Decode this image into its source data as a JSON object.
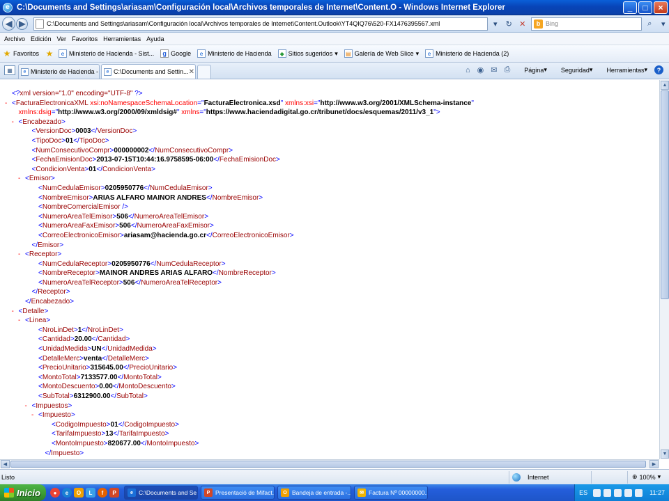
{
  "window": {
    "title": "C:\\Documents and Settings\\ariasam\\Configuración local\\Archivos temporales de Internet\\Content.O - Windows Internet Explorer"
  },
  "address": {
    "url": "C:\\Documents and Settings\\ariasam\\Configuración local\\Archivos temporales de Internet\\Content.Outlook\\YT4QIQ76\\520-FX1476395567.xml",
    "search_placeholder": "Bing"
  },
  "menu": [
    "Archivo",
    "Edición",
    "Ver",
    "Favoritos",
    "Herramientas",
    "Ayuda"
  ],
  "favorites": {
    "label": "Favoritos",
    "items": [
      "Ministerio de Hacienda - Sist...",
      "Google",
      "Ministerio de Hacienda",
      "Sitios sugeridos",
      "Galería de Web Slice",
      "Ministerio de Hacienda (2)"
    ]
  },
  "tabs": [
    {
      "label": "Ministerio de Hacienda - Siste...",
      "active": false
    },
    {
      "label": "C:\\Documents and Settin...",
      "active": true
    }
  ],
  "commands": {
    "page": "Página",
    "security": "Seguridad",
    "tools": "Herramientas"
  },
  "xml_lines": [
    {
      "ind": 0,
      "m": "",
      "html": "<span class='bl'>&lt;?</span><span class='tg'>xml version=\"1.0\" encoding=\"UTF-8\"</span><span class='bl'> ?&gt;</span>"
    },
    {
      "ind": 0,
      "m": "-",
      "html": "<span class='bl'>&lt;</span><span class='tg'>FacturaElectronicaXML</span> <span class='an'>xsi:noNamespaceSchemaLocation</span><span class='bl'>=\"</span><span class='av'>FacturaElectronica.xsd</span><span class='bl'>\"</span> <span class='an'>xmlns:xsi</span><span class='bl'>=\"</span><span class='av'>http://www.w3.org/2001/XMLSchema-instance</span><span class='bl'>\"</span>"
    },
    {
      "ind": 1,
      "m": "",
      "html": "<span class='an'>xmlns:dsig</span><span class='bl'>=\"</span><span class='av'>http://www.w3.org/2000/09/xmldsig#</span><span class='bl'>\"</span> <span class='an'>xmlns</span><span class='bl'>=\"</span><span class='av'>https://www.haciendadigital.go.cr/tribunet/docs/esquemas/2011/v3_1</span><span class='bl'>\"&gt;</span>"
    },
    {
      "ind": 1,
      "m": "-",
      "html": "<span class='bl'>&lt;</span><span class='tg'>Encabezado</span><span class='bl'>&gt;</span>"
    },
    {
      "ind": 3,
      "m": "",
      "html": "<span class='bl'>&lt;</span><span class='tg'>VersionDoc</span><span class='bl'>&gt;</span><span class='tx'>0003</span><span class='bl'>&lt;/</span><span class='tg'>VersionDoc</span><span class='bl'>&gt;</span>"
    },
    {
      "ind": 3,
      "m": "",
      "html": "<span class='bl'>&lt;</span><span class='tg'>TipoDoc</span><span class='bl'>&gt;</span><span class='tx'>01</span><span class='bl'>&lt;/</span><span class='tg'>TipoDoc</span><span class='bl'>&gt;</span>"
    },
    {
      "ind": 3,
      "m": "",
      "html": "<span class='bl'>&lt;</span><span class='tg'>NumConsecutivoCompr</span><span class='bl'>&gt;</span><span class='tx'>000000002</span><span class='bl'>&lt;/</span><span class='tg'>NumConsecutivoCompr</span><span class='bl'>&gt;</span>"
    },
    {
      "ind": 3,
      "m": "",
      "html": "<span class='bl'>&lt;</span><span class='tg'>FechaEmisionDoc</span><span class='bl'>&gt;</span><span class='tx'>2013-07-15T10:44:16.9758595-06:00</span><span class='bl'>&lt;/</span><span class='tg'>FechaEmisionDoc</span><span class='bl'>&gt;</span>"
    },
    {
      "ind": 3,
      "m": "",
      "html": "<span class='bl'>&lt;</span><span class='tg'>CondicionVenta</span><span class='bl'>&gt;</span><span class='tx'>01</span><span class='bl'>&lt;/</span><span class='tg'>CondicionVenta</span><span class='bl'>&gt;</span>"
    },
    {
      "ind": 2,
      "m": "-",
      "html": "<span class='bl'>&lt;</span><span class='tg'>Emisor</span><span class='bl'>&gt;</span>"
    },
    {
      "ind": 4,
      "m": "",
      "html": "<span class='bl'>&lt;</span><span class='tg'>NumCedulaEmisor</span><span class='bl'>&gt;</span><span class='tx'>0205950776</span><span class='bl'>&lt;/</span><span class='tg'>NumCedulaEmisor</span><span class='bl'>&gt;</span>"
    },
    {
      "ind": 4,
      "m": "",
      "html": "<span class='bl'>&lt;</span><span class='tg'>NombreEmisor</span><span class='bl'>&gt;</span><span class='tx'>ARIAS ALFARO MAINOR ANDRES</span><span class='bl'>&lt;/</span><span class='tg'>NombreEmisor</span><span class='bl'>&gt;</span>"
    },
    {
      "ind": 4,
      "m": "",
      "html": "<span class='bl'>&lt;</span><span class='tg'>NombreComercialEmisor</span><span class='bl'> /&gt;</span>"
    },
    {
      "ind": 4,
      "m": "",
      "html": "<span class='bl'>&lt;</span><span class='tg'>NumeroAreaTelEmisor</span><span class='bl'>&gt;</span><span class='tx'>506</span><span class='bl'>&lt;/</span><span class='tg'>NumeroAreaTelEmisor</span><span class='bl'>&gt;</span>"
    },
    {
      "ind": 4,
      "m": "",
      "html": "<span class='bl'>&lt;</span><span class='tg'>NumeroAreaFaxEmisor</span><span class='bl'>&gt;</span><span class='tx'>506</span><span class='bl'>&lt;/</span><span class='tg'>NumeroAreaFaxEmisor</span><span class='bl'>&gt;</span>"
    },
    {
      "ind": 4,
      "m": "",
      "html": "<span class='bl'>&lt;</span><span class='tg'>CorreoElectronicoEmisor</span><span class='bl'>&gt;</span><span class='tx'>ariasam@hacienda.go.cr</span><span class='bl'>&lt;/</span><span class='tg'>CorreoElectronicoEmisor</span><span class='bl'>&gt;</span>"
    },
    {
      "ind": 3,
      "m": "",
      "html": "<span class='bl'>&lt;/</span><span class='tg'>Emisor</span><span class='bl'>&gt;</span>"
    },
    {
      "ind": 2,
      "m": "-",
      "html": "<span class='bl'>&lt;</span><span class='tg'>Receptor</span><span class='bl'>&gt;</span>"
    },
    {
      "ind": 4,
      "m": "",
      "html": "<span class='bl'>&lt;</span><span class='tg'>NumCedulaReceptor</span><span class='bl'>&gt;</span><span class='tx'>0205950776</span><span class='bl'>&lt;/</span><span class='tg'>NumCedulaReceptor</span><span class='bl'>&gt;</span>"
    },
    {
      "ind": 4,
      "m": "",
      "html": "<span class='bl'>&lt;</span><span class='tg'>NombreReceptor</span><span class='bl'>&gt;</span><span class='tx'>MAINOR ANDRES ARIAS ALFARO</span><span class='bl'>&lt;/</span><span class='tg'>NombreReceptor</span><span class='bl'>&gt;</span>"
    },
    {
      "ind": 4,
      "m": "",
      "html": "<span class='bl'>&lt;</span><span class='tg'>NumeroAreaTelReceptor</span><span class='bl'>&gt;</span><span class='tx'>506</span><span class='bl'>&lt;/</span><span class='tg'>NumeroAreaTelReceptor</span><span class='bl'>&gt;</span>"
    },
    {
      "ind": 3,
      "m": "",
      "html": "<span class='bl'>&lt;/</span><span class='tg'>Receptor</span><span class='bl'>&gt;</span>"
    },
    {
      "ind": 2,
      "m": "",
      "html": "<span class='bl'>&lt;/</span><span class='tg'>Encabezado</span><span class='bl'>&gt;</span>"
    },
    {
      "ind": 1,
      "m": "-",
      "html": "<span class='bl'>&lt;</span><span class='tg'>Detalle</span><span class='bl'>&gt;</span>"
    },
    {
      "ind": 2,
      "m": "-",
      "html": "<span class='bl'>&lt;</span><span class='tg'>Linea</span><span class='bl'>&gt;</span>"
    },
    {
      "ind": 4,
      "m": "",
      "html": "<span class='bl'>&lt;</span><span class='tg'>NroLinDet</span><span class='bl'>&gt;</span><span class='tx'>1</span><span class='bl'>&lt;/</span><span class='tg'>NroLinDet</span><span class='bl'>&gt;</span>"
    },
    {
      "ind": 4,
      "m": "",
      "html": "<span class='bl'>&lt;</span><span class='tg'>Cantidad</span><span class='bl'>&gt;</span><span class='tx'>20.00</span><span class='bl'>&lt;/</span><span class='tg'>Cantidad</span><span class='bl'>&gt;</span>"
    },
    {
      "ind": 4,
      "m": "",
      "html": "<span class='bl'>&lt;</span><span class='tg'>UnidadMedida</span><span class='bl'>&gt;</span><span class='tx'>UN</span><span class='bl'>&lt;/</span><span class='tg'>UnidadMedida</span><span class='bl'>&gt;</span>"
    },
    {
      "ind": 4,
      "m": "",
      "html": "<span class='bl'>&lt;</span><span class='tg'>DetalleMerc</span><span class='bl'>&gt;</span><span class='tx'>venta</span><span class='bl'>&lt;/</span><span class='tg'>DetalleMerc</span><span class='bl'>&gt;</span>"
    },
    {
      "ind": 4,
      "m": "",
      "html": "<span class='bl'>&lt;</span><span class='tg'>PrecioUnitario</span><span class='bl'>&gt;</span><span class='tx'>315645.00</span><span class='bl'>&lt;/</span><span class='tg'>PrecioUnitario</span><span class='bl'>&gt;</span>"
    },
    {
      "ind": 4,
      "m": "",
      "html": "<span class='bl'>&lt;</span><span class='tg'>MontoTotal</span><span class='bl'>&gt;</span><span class='tx'>7133577.00</span><span class='bl'>&lt;/</span><span class='tg'>MontoTotal</span><span class='bl'>&gt;</span>"
    },
    {
      "ind": 4,
      "m": "",
      "html": "<span class='bl'>&lt;</span><span class='tg'>MontoDescuento</span><span class='bl'>&gt;</span><span class='tx'>0.00</span><span class='bl'>&lt;/</span><span class='tg'>MontoDescuento</span><span class='bl'>&gt;</span>"
    },
    {
      "ind": 4,
      "m": "",
      "html": "<span class='bl'>&lt;</span><span class='tg'>SubTotal</span><span class='bl'>&gt;</span><span class='tx'>6312900.00</span><span class='bl'>&lt;/</span><span class='tg'>SubTotal</span><span class='bl'>&gt;</span>"
    },
    {
      "ind": 3,
      "m": "-",
      "html": "<span class='bl'>&lt;</span><span class='tg'>Impuestos</span><span class='bl'>&gt;</span>"
    },
    {
      "ind": 4,
      "m": "-",
      "html": "<span class='bl'>&lt;</span><span class='tg'>Impuesto</span><span class='bl'>&gt;</span>"
    },
    {
      "ind": 6,
      "m": "",
      "html": "<span class='bl'>&lt;</span><span class='tg'>CodigoImpuesto</span><span class='bl'>&gt;</span><span class='tx'>01</span><span class='bl'>&lt;/</span><span class='tg'>CodigoImpuesto</span><span class='bl'>&gt;</span>"
    },
    {
      "ind": 6,
      "m": "",
      "html": "<span class='bl'>&lt;</span><span class='tg'>TarifaImpuesto</span><span class='bl'>&gt;</span><span class='tx'>13</span><span class='bl'>&lt;/</span><span class='tg'>TarifaImpuesto</span><span class='bl'>&gt;</span>"
    },
    {
      "ind": 6,
      "m": "",
      "html": "<span class='bl'>&lt;</span><span class='tg'>MontoImpuesto</span><span class='bl'>&gt;</span><span class='tx'>820677.00</span><span class='bl'>&lt;/</span><span class='tg'>MontoImpuesto</span><span class='bl'>&gt;</span>"
    },
    {
      "ind": 5,
      "m": "",
      "html": "<span class='bl'>&lt;/</span><span class='tg'>Impuesto</span><span class='bl'>&gt;</span>"
    }
  ],
  "status": {
    "text": "Listo",
    "zone": "Internet",
    "zoom": "100%"
  },
  "taskbar": {
    "start": "Inicio",
    "tasks": [
      {
        "label": "C:\\Documents and Se...",
        "color": "#1a6fd8",
        "active": true
      },
      {
        "label": "Presentació de Mifact...",
        "color": "#d24726",
        "active": false
      },
      {
        "label": "Bandeja de entrada -...",
        "color": "#f0a000",
        "active": false
      },
      {
        "label": "Factura Nº 00000000...",
        "color": "#f0b400",
        "active": false
      }
    ],
    "lang": "ES",
    "clock": "11:27"
  },
  "colors": {
    "tag": "#990000",
    "attr": "#ff0000",
    "markup": "#0000ff"
  }
}
